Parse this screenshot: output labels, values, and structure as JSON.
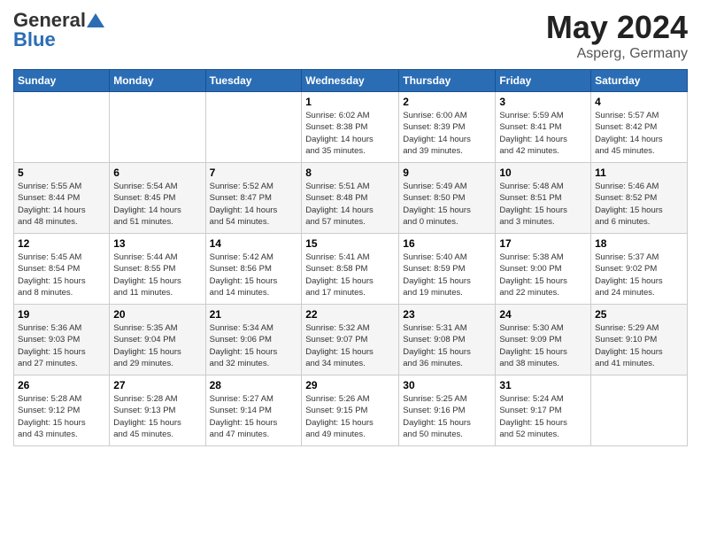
{
  "logo": {
    "general": "General",
    "blue": "Blue"
  },
  "title": "May 2024",
  "location": "Asperg, Germany",
  "days_header": [
    "Sunday",
    "Monday",
    "Tuesday",
    "Wednesday",
    "Thursday",
    "Friday",
    "Saturday"
  ],
  "weeks": [
    [
      {
        "num": "",
        "info": ""
      },
      {
        "num": "",
        "info": ""
      },
      {
        "num": "",
        "info": ""
      },
      {
        "num": "1",
        "info": "Sunrise: 6:02 AM\nSunset: 8:38 PM\nDaylight: 14 hours\nand 35 minutes."
      },
      {
        "num": "2",
        "info": "Sunrise: 6:00 AM\nSunset: 8:39 PM\nDaylight: 14 hours\nand 39 minutes."
      },
      {
        "num": "3",
        "info": "Sunrise: 5:59 AM\nSunset: 8:41 PM\nDaylight: 14 hours\nand 42 minutes."
      },
      {
        "num": "4",
        "info": "Sunrise: 5:57 AM\nSunset: 8:42 PM\nDaylight: 14 hours\nand 45 minutes."
      }
    ],
    [
      {
        "num": "5",
        "info": "Sunrise: 5:55 AM\nSunset: 8:44 PM\nDaylight: 14 hours\nand 48 minutes."
      },
      {
        "num": "6",
        "info": "Sunrise: 5:54 AM\nSunset: 8:45 PM\nDaylight: 14 hours\nand 51 minutes."
      },
      {
        "num": "7",
        "info": "Sunrise: 5:52 AM\nSunset: 8:47 PM\nDaylight: 14 hours\nand 54 minutes."
      },
      {
        "num": "8",
        "info": "Sunrise: 5:51 AM\nSunset: 8:48 PM\nDaylight: 14 hours\nand 57 minutes."
      },
      {
        "num": "9",
        "info": "Sunrise: 5:49 AM\nSunset: 8:50 PM\nDaylight: 15 hours\nand 0 minutes."
      },
      {
        "num": "10",
        "info": "Sunrise: 5:48 AM\nSunset: 8:51 PM\nDaylight: 15 hours\nand 3 minutes."
      },
      {
        "num": "11",
        "info": "Sunrise: 5:46 AM\nSunset: 8:52 PM\nDaylight: 15 hours\nand 6 minutes."
      }
    ],
    [
      {
        "num": "12",
        "info": "Sunrise: 5:45 AM\nSunset: 8:54 PM\nDaylight: 15 hours\nand 8 minutes."
      },
      {
        "num": "13",
        "info": "Sunrise: 5:44 AM\nSunset: 8:55 PM\nDaylight: 15 hours\nand 11 minutes."
      },
      {
        "num": "14",
        "info": "Sunrise: 5:42 AM\nSunset: 8:56 PM\nDaylight: 15 hours\nand 14 minutes."
      },
      {
        "num": "15",
        "info": "Sunrise: 5:41 AM\nSunset: 8:58 PM\nDaylight: 15 hours\nand 17 minutes."
      },
      {
        "num": "16",
        "info": "Sunrise: 5:40 AM\nSunset: 8:59 PM\nDaylight: 15 hours\nand 19 minutes."
      },
      {
        "num": "17",
        "info": "Sunrise: 5:38 AM\nSunset: 9:00 PM\nDaylight: 15 hours\nand 22 minutes."
      },
      {
        "num": "18",
        "info": "Sunrise: 5:37 AM\nSunset: 9:02 PM\nDaylight: 15 hours\nand 24 minutes."
      }
    ],
    [
      {
        "num": "19",
        "info": "Sunrise: 5:36 AM\nSunset: 9:03 PM\nDaylight: 15 hours\nand 27 minutes."
      },
      {
        "num": "20",
        "info": "Sunrise: 5:35 AM\nSunset: 9:04 PM\nDaylight: 15 hours\nand 29 minutes."
      },
      {
        "num": "21",
        "info": "Sunrise: 5:34 AM\nSunset: 9:06 PM\nDaylight: 15 hours\nand 32 minutes."
      },
      {
        "num": "22",
        "info": "Sunrise: 5:32 AM\nSunset: 9:07 PM\nDaylight: 15 hours\nand 34 minutes."
      },
      {
        "num": "23",
        "info": "Sunrise: 5:31 AM\nSunset: 9:08 PM\nDaylight: 15 hours\nand 36 minutes."
      },
      {
        "num": "24",
        "info": "Sunrise: 5:30 AM\nSunset: 9:09 PM\nDaylight: 15 hours\nand 38 minutes."
      },
      {
        "num": "25",
        "info": "Sunrise: 5:29 AM\nSunset: 9:10 PM\nDaylight: 15 hours\nand 41 minutes."
      }
    ],
    [
      {
        "num": "26",
        "info": "Sunrise: 5:28 AM\nSunset: 9:12 PM\nDaylight: 15 hours\nand 43 minutes."
      },
      {
        "num": "27",
        "info": "Sunrise: 5:28 AM\nSunset: 9:13 PM\nDaylight: 15 hours\nand 45 minutes."
      },
      {
        "num": "28",
        "info": "Sunrise: 5:27 AM\nSunset: 9:14 PM\nDaylight: 15 hours\nand 47 minutes."
      },
      {
        "num": "29",
        "info": "Sunrise: 5:26 AM\nSunset: 9:15 PM\nDaylight: 15 hours\nand 49 minutes."
      },
      {
        "num": "30",
        "info": "Sunrise: 5:25 AM\nSunset: 9:16 PM\nDaylight: 15 hours\nand 50 minutes."
      },
      {
        "num": "31",
        "info": "Sunrise: 5:24 AM\nSunset: 9:17 PM\nDaylight: 15 hours\nand 52 minutes."
      },
      {
        "num": "",
        "info": ""
      }
    ]
  ]
}
